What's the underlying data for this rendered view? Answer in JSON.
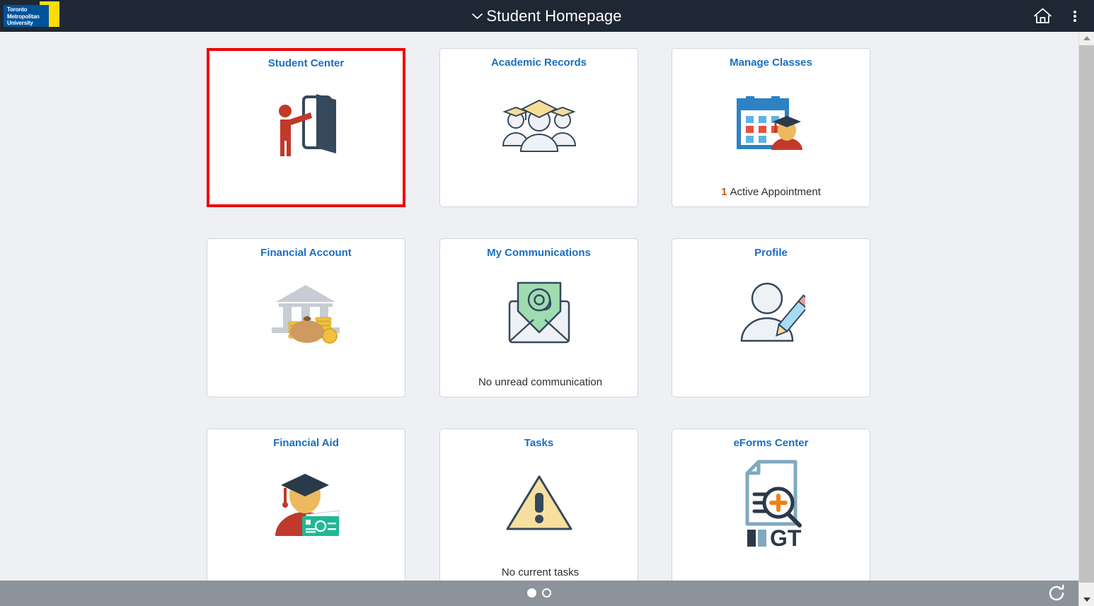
{
  "header": {
    "logo": {
      "line1": "Toronto",
      "line2": "Metropolitan",
      "line3": "University"
    },
    "title": "Student Homepage",
    "chevron": "⌄",
    "icons": {
      "home": "home-icon",
      "actions": "actions-kebab-icon"
    }
  },
  "tiles": [
    {
      "title": "Student Center",
      "icon": "person-opening-door-icon",
      "footer": "",
      "count": "",
      "selected": true
    },
    {
      "title": "Academic Records",
      "icon": "graduates-group-icon",
      "footer": "",
      "count": "",
      "selected": false
    },
    {
      "title": "Manage Classes",
      "icon": "calendar-graduate-icon",
      "footer": "Active Appointment",
      "count": "1",
      "selected": false
    },
    {
      "title": "Financial Account",
      "icon": "bank-moneybag-icon",
      "footer": "",
      "count": "",
      "selected": false
    },
    {
      "title": "My Communications",
      "icon": "envelope-at-icon",
      "footer": "No unread communication",
      "count": "",
      "selected": false
    },
    {
      "title": "Profile",
      "icon": "person-pencil-icon",
      "footer": "",
      "count": "",
      "selected": false
    },
    {
      "title": "Financial Aid",
      "icon": "graduate-cash-icon",
      "footer": "",
      "count": "",
      "selected": false
    },
    {
      "title": "Tasks",
      "icon": "warning-triangle-icon",
      "footer": "No current tasks",
      "count": "",
      "selected": false
    },
    {
      "title": "eForms Center",
      "icon": "document-search-gt-icon",
      "footer": "",
      "count": "",
      "selected": false
    }
  ],
  "pager": {
    "pages": 2,
    "active": 1
  },
  "bottom": {
    "refresh": "refresh-icon"
  },
  "colors": {
    "header_bg": "#1e2733",
    "page_bg": "#eef0f4",
    "tile_title": "#1b6ec2",
    "selection": "#ee0000",
    "brand_blue": "#00529b",
    "brand_yellow": "#ffdd00",
    "bottom_bar": "#8d939b",
    "count_orange": "#bb5a11"
  }
}
